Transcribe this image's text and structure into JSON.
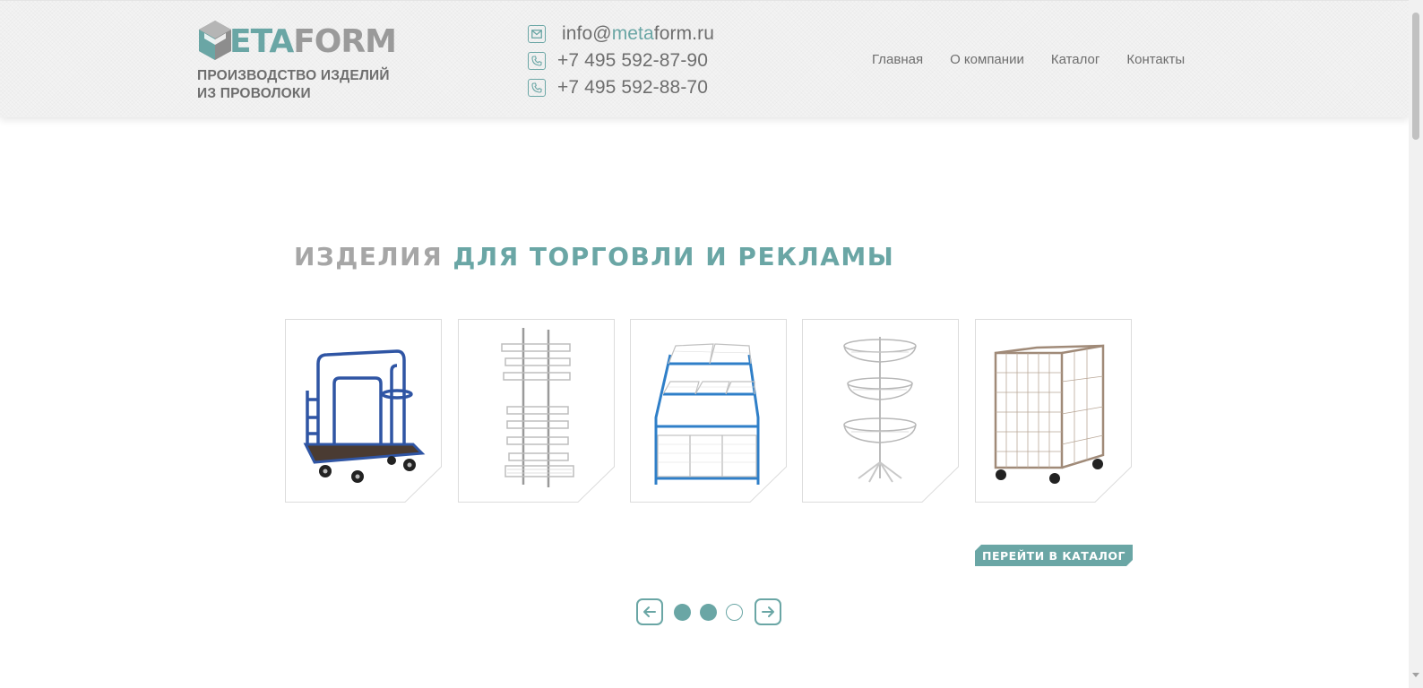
{
  "header": {
    "logo": {
      "part1": "M",
      "part2": "ETA",
      "part3": "FORM"
    },
    "tagline_line1": "ПРОИЗВОДСТВО ИЗДЕЛИЙ",
    "tagline_line2": "ИЗ ПРОВОЛОКИ",
    "email_prefix": "info@",
    "email_accent": "meta",
    "email_suffix": "form.ru",
    "phones": [
      "+7 495 592-87-90",
      "+7 495 592-88-70"
    ],
    "nav": [
      "Главная",
      "О компании",
      "Каталог",
      "Контакты"
    ]
  },
  "section": {
    "title_grey": "ИЗДЕЛИЯ",
    "title_teal": "ДЛЯ ТОРГОВЛИ И РЕКЛАМЫ"
  },
  "products": [
    {
      "name": "platform-cart"
    },
    {
      "name": "wall-rack"
    },
    {
      "name": "basket-display"
    },
    {
      "name": "rotating-basket-stand"
    },
    {
      "name": "mesh-roll-container"
    }
  ],
  "catalog_button": "ПЕРЕЙТИ В КАТАЛОГ",
  "pager": {
    "active_page": 3,
    "pages": 3
  },
  "colors": {
    "accent": "#6aa6a5",
    "grey": "#a6a6a6",
    "text": "#6e6e6e"
  }
}
